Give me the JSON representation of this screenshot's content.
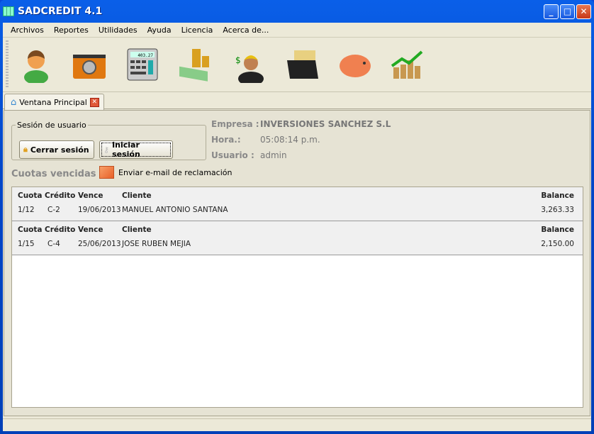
{
  "window": {
    "title": "SADCREDIT 4.1",
    "controls": [
      "minimize",
      "maximize",
      "close"
    ]
  },
  "menu": [
    "Archivos",
    "Reportes",
    "Utilidades",
    "Ayuda",
    "Licencia",
    "Acerca de..."
  ],
  "toolbar": {
    "icons": [
      "user-icon",
      "safe-folder-icon",
      "calculator-icon",
      "money-coins-icon",
      "businessman-money-icon",
      "file-box-icon",
      "piggy-bank-icon",
      "growth-chart-icon"
    ],
    "calculator_display": "403.27"
  },
  "tab": {
    "label": "Ventana Principal"
  },
  "session": {
    "legend": "Sesión de usuario",
    "logout": "Cerrar sesión",
    "login": "Iniciar sesión"
  },
  "info": {
    "empresa_label": "Empresa :",
    "empresa": "INVERSIONES SANCHEZ S.L",
    "hora_label": "Hora.:",
    "hora": "05:08:14 p.m.",
    "usuario_label": "Usuario :",
    "usuario": "admin"
  },
  "overdue": {
    "title": "Cuotas vencidas",
    "email_button": "Enviar e-mail de reclamación",
    "headers": {
      "cuota": "Cuota",
      "credito": "Crédito",
      "vence": "Vence",
      "cliente": "Cliente",
      "balance": "Balance"
    },
    "rows": [
      {
        "cuota": "1/12",
        "credito": "C-2",
        "vence": "19/06/2013",
        "cliente": "MANUEL ANTONIO SANTANA",
        "balance": "3,263.33"
      },
      {
        "cuota": "1/15",
        "credito": "C-4",
        "vence": "25/06/2013",
        "cliente": "JOSE RUBEN MEJIA",
        "balance": "2,150.00"
      }
    ]
  }
}
